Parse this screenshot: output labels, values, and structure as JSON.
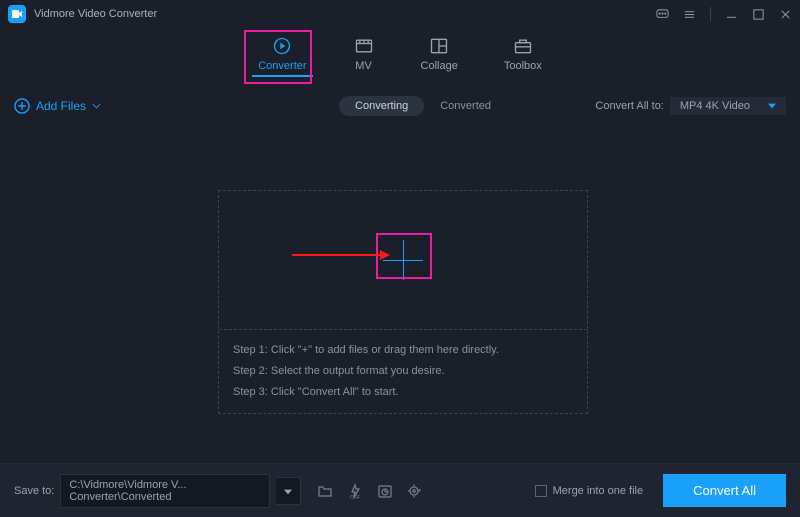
{
  "app": {
    "title": "Vidmore Video Converter"
  },
  "tabs": {
    "converter": "Converter",
    "mv": "MV",
    "collage": "Collage",
    "toolbox": "Toolbox"
  },
  "toolbar": {
    "add_files": "Add Files",
    "converting": "Converting",
    "converted": "Converted",
    "convert_all_to": "Convert All to:",
    "selected_format": "MP4 4K Video"
  },
  "steps": {
    "s1": "Step 1: Click \"+\" to add files or drag them here directly.",
    "s2": "Step 2: Select the output format you desire.",
    "s3": "Step 3: Click \"Convert All\" to start."
  },
  "bottom": {
    "save_to_label": "Save to:",
    "path": "C:\\Vidmore\\Vidmore V... Converter\\Converted",
    "merge_label": "Merge into one file",
    "convert_all": "Convert All"
  }
}
